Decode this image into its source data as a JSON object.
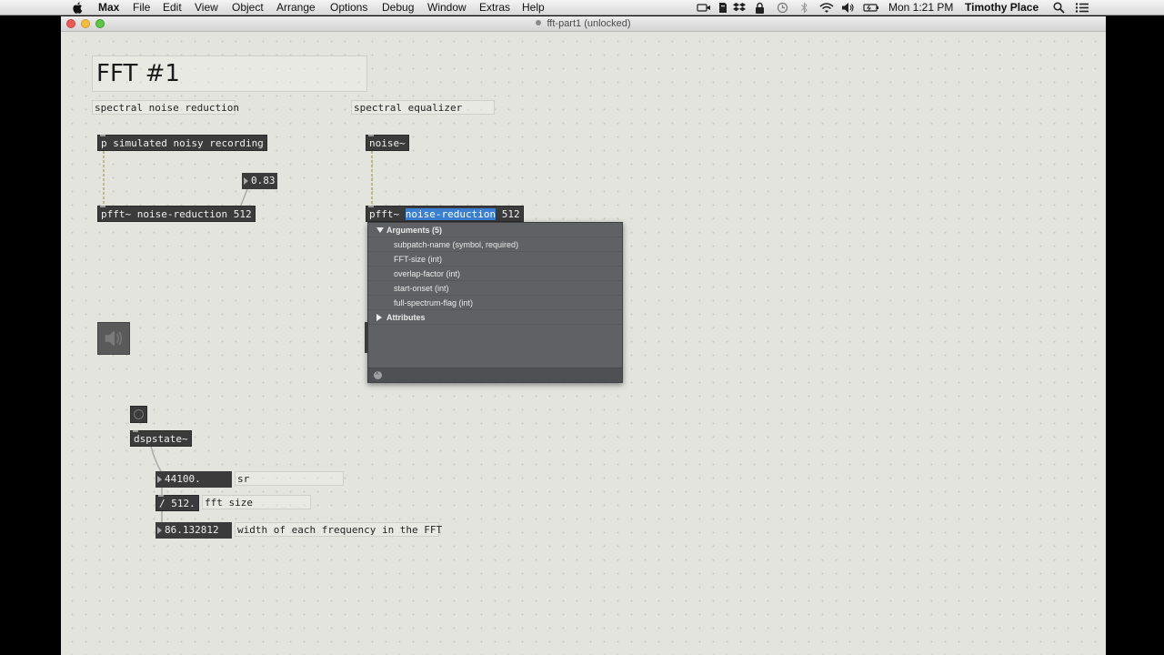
{
  "menubar": {
    "app_name": "Max",
    "items": [
      "File",
      "Edit",
      "View",
      "Object",
      "Arrange",
      "Options",
      "Debug",
      "Window",
      "Extras",
      "Help"
    ],
    "clock": "Mon 1:21 PM",
    "user": "Timothy Place"
  },
  "window": {
    "title": "fft-part1 (unlocked)"
  },
  "patch": {
    "title": "FFT #1",
    "comment_noise_reduction": "spectral noise reduction",
    "comment_equalizer": "spectral equalizer",
    "obj_simulated": "p simulated noisy recording",
    "obj_noise": "noise~",
    "flonum_value": "0.83",
    "obj_pfft_left": "pfft~ noise-reduction 512",
    "obj_pfft_right_prefix": "pfft~ ",
    "obj_pfft_right_selected": "noise-reduction",
    "obj_pfft_right_suffix": " 512",
    "obj_dspstate": "dspstate~",
    "num_sr": "44100.",
    "comment_sr": "sr",
    "obj_divide": "/ 512.",
    "comment_fft_size": "fft size",
    "num_width": "86.132812",
    "comment_width": "width of each frequency in the FFT"
  },
  "popup": {
    "arguments_header": "Arguments (5)",
    "arguments": [
      "subpatch-name (symbol, required)",
      "FFT-size (int)",
      "overlap-factor (int)",
      "start-onset (int)",
      "full-spectrum-flag (int)"
    ],
    "attributes_header": "Attributes"
  }
}
